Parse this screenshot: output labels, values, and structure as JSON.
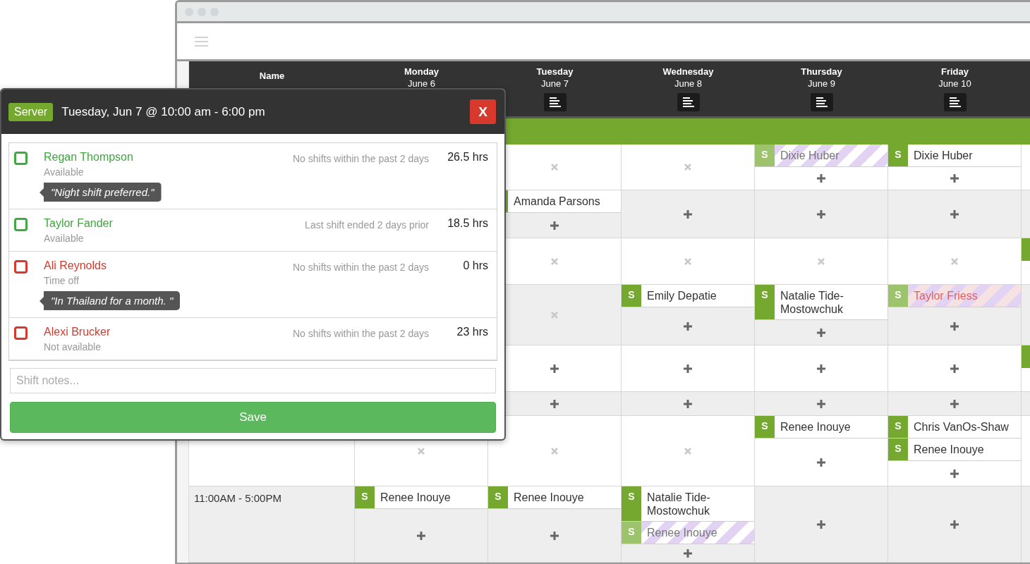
{
  "header": {
    "name_label": "Name",
    "days": [
      {
        "day": "Monday",
        "date": "June 6",
        "summary_button": false
      },
      {
        "day": "Tuesday",
        "date": "June 7",
        "summary_button": true
      },
      {
        "day": "Wednesday",
        "date": "June 8",
        "summary_button": true
      },
      {
        "day": "Thursday",
        "date": "June 9",
        "summary_button": true
      },
      {
        "day": "Friday",
        "date": "June 10",
        "summary_button": true
      }
    ]
  },
  "rows": [
    {
      "shaded": false,
      "cells": [
        {
          "kind": "covered"
        },
        {
          "kind": "blocked"
        },
        {
          "kind": "blocked"
        },
        {
          "kind": "shifts",
          "shifts": [
            {
              "badge": "S",
              "name": "Dixie Huber",
              "kind": "pending"
            }
          ]
        },
        {
          "kind": "shifts",
          "shifts": [
            {
              "badge": "S",
              "name": "Dixie Huber",
              "kind": "confirmed"
            }
          ]
        },
        {
          "kind": "blank"
        }
      ]
    },
    {
      "shaded": true,
      "cells": [
        {
          "kind": "covered"
        },
        {
          "kind": "shifts",
          "shifts": [
            {
              "name": "Amanda Parsons",
              "kind": "confirmed"
            }
          ]
        },
        {
          "kind": "open"
        },
        {
          "kind": "open"
        },
        {
          "kind": "open"
        },
        {
          "kind": "blank"
        }
      ]
    },
    {
      "shaded": false,
      "cells": [
        {
          "kind": "covered"
        },
        {
          "kind": "blocked"
        },
        {
          "kind": "blocked"
        },
        {
          "kind": "blocked"
        },
        {
          "kind": "blocked"
        },
        {
          "kind": "edge_shift"
        }
      ]
    },
    {
      "shaded": true,
      "cells": [
        {
          "kind": "covered"
        },
        {
          "kind": "blocked"
        },
        {
          "kind": "shifts",
          "shifts": [
            {
              "badge": "S",
              "name": "Emily Depatie",
              "kind": "confirmed"
            }
          ]
        },
        {
          "kind": "shifts",
          "shifts": [
            {
              "badge": "S",
              "name": "Natalie Tide-Mostowchuk",
              "kind": "confirmed"
            }
          ]
        },
        {
          "kind": "shifts",
          "shifts": [
            {
              "badge": "S",
              "name": "Taylor Friess",
              "kind": "conflict"
            }
          ]
        },
        {
          "kind": "blank"
        }
      ]
    },
    {
      "shaded": false,
      "cells": [
        {
          "kind": "covered"
        },
        {
          "kind": "open"
        },
        {
          "kind": "open"
        },
        {
          "kind": "open"
        },
        {
          "kind": "open"
        },
        {
          "kind": "edge_shift"
        }
      ]
    },
    {
      "shaded": true,
      "cells": [
        {
          "kind": "covered"
        },
        {
          "kind": "open"
        },
        {
          "kind": "open"
        },
        {
          "kind": "open"
        },
        {
          "kind": "open"
        },
        {
          "kind": "blank"
        }
      ]
    },
    {
      "shaded": false,
      "cells": [
        {
          "kind": "blocked"
        },
        {
          "kind": "blocked"
        },
        {
          "kind": "blocked"
        },
        {
          "kind": "shifts",
          "shifts": [
            {
              "badge": "S",
              "name": "Renee Inouye",
              "kind": "confirmed"
            }
          ]
        },
        {
          "kind": "shifts",
          "shifts": [
            {
              "badge": "S",
              "name": "Chris VanOs-Shaw",
              "kind": "confirmed"
            },
            {
              "badge": "S",
              "name": "Renee Inouye",
              "kind": "confirmed"
            }
          ]
        },
        {
          "kind": "blank"
        }
      ]
    },
    {
      "shaded": true,
      "label": "11:00AM - 5:00PM",
      "cells": [
        {
          "kind": "shifts",
          "shifts": [
            {
              "badge": "S",
              "name": "Renee Inouye",
              "kind": "confirmed"
            }
          ]
        },
        {
          "kind": "shifts",
          "shifts": [
            {
              "badge": "S",
              "name": "Renee Inouye",
              "kind": "confirmed"
            }
          ]
        },
        {
          "kind": "shifts",
          "shifts": [
            {
              "badge": "S",
              "name": "Natalie Tide-Mostowchuk",
              "kind": "confirmed"
            },
            {
              "badge": "S",
              "name": "Renee Inouye",
              "kind": "pending"
            }
          ]
        },
        {
          "kind": "open"
        },
        {
          "kind": "open"
        },
        {
          "kind": "blank"
        }
      ]
    }
  ],
  "shift_dialog": {
    "role": "Server",
    "title": "Tuesday, Jun 7 @ 10:00 am - 6:00 pm",
    "close_label": "X",
    "candidates": [
      {
        "name": "Regan Thompson",
        "available": true,
        "checked": false,
        "status": "Available",
        "note": "\"Night shift preferred.\"",
        "history": "No shifts within the past 2 days",
        "hours": "26.5 hrs"
      },
      {
        "name": "Taylor Fander",
        "available": true,
        "checked": false,
        "status": "Available",
        "history": "Last shift ended 2 days prior",
        "hours": "18.5 hrs"
      },
      {
        "name": "Ali Reynolds",
        "available": false,
        "checked": false,
        "status": "Time off",
        "note": "\"In Thailand for a month. \"",
        "history": "No shifts within the past 2 days",
        "hours": "0 hrs"
      },
      {
        "name": "Alexi Brucker",
        "available": false,
        "checked": false,
        "status": "Not available",
        "history": "No shifts within the past 2 days",
        "hours": "23 hrs"
      }
    ],
    "notes_placeholder": "Shift notes...",
    "save_label": "Save"
  }
}
